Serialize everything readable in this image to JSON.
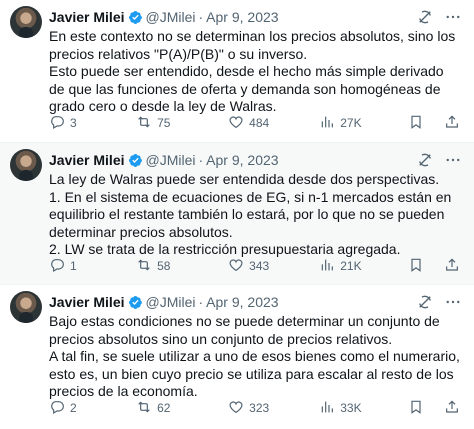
{
  "tweets": [
    {
      "author_name": "Javier Milei",
      "handle": "@JMilei",
      "separator": "·",
      "date": "Apr 9, 2023",
      "paragraphs": [
        "En este contexto no se determinan los precios absolutos, sino los precios relativos \"P(A)/P(B)\" o su inverso.",
        "Esto puede ser entendido, desde el hecho más simple derivado de que las funciones de oferta y demanda son homogéneas de grado cero o desde la ley de Walras."
      ],
      "replies": "3",
      "retweets": "75",
      "likes": "484",
      "views": "27K"
    },
    {
      "author_name": "Javier Milei",
      "handle": "@JMilei",
      "separator": "·",
      "date": "Apr 9, 2023",
      "paragraphs": [
        "La ley de Walras puede ser entendida desde dos perspectivas.",
        "1. En el sistema de ecuaciones de EG, si n-1 mercados están en equilibrio el restante también lo estará, por lo que no se pueden determinar precios absolutos.",
        "2. LW se trata de la restricción presupuestaria agregada."
      ],
      "replies": "1",
      "retweets": "58",
      "likes": "343",
      "views": "21K"
    },
    {
      "author_name": "Javier Milei",
      "handle": "@JMilei",
      "separator": "·",
      "date": "Apr 9, 2023",
      "paragraphs": [
        "Bajo estas condiciones no se puede determinar un conjunto de precios absolutos sino un conjunto de precios relativos.",
        "A tal fin, se suele utilizar a uno de esos bienes como el numerario, esto es, un bien cuyo precio se utiliza para escalar al resto de los precios de la economía."
      ],
      "replies": "2",
      "retweets": "62",
      "likes": "323",
      "views": "33K"
    }
  ],
  "colors": {
    "text": "#0f1419",
    "secondary": "#536471",
    "verified": "#1d9bf0",
    "highlight_bg": "#f7f9f9"
  },
  "icons": [
    "verified-badge-icon",
    "grok-icon",
    "more-icon",
    "reply-icon",
    "retweet-icon",
    "like-icon",
    "views-icon",
    "bookmark-icon",
    "share-icon"
  ]
}
